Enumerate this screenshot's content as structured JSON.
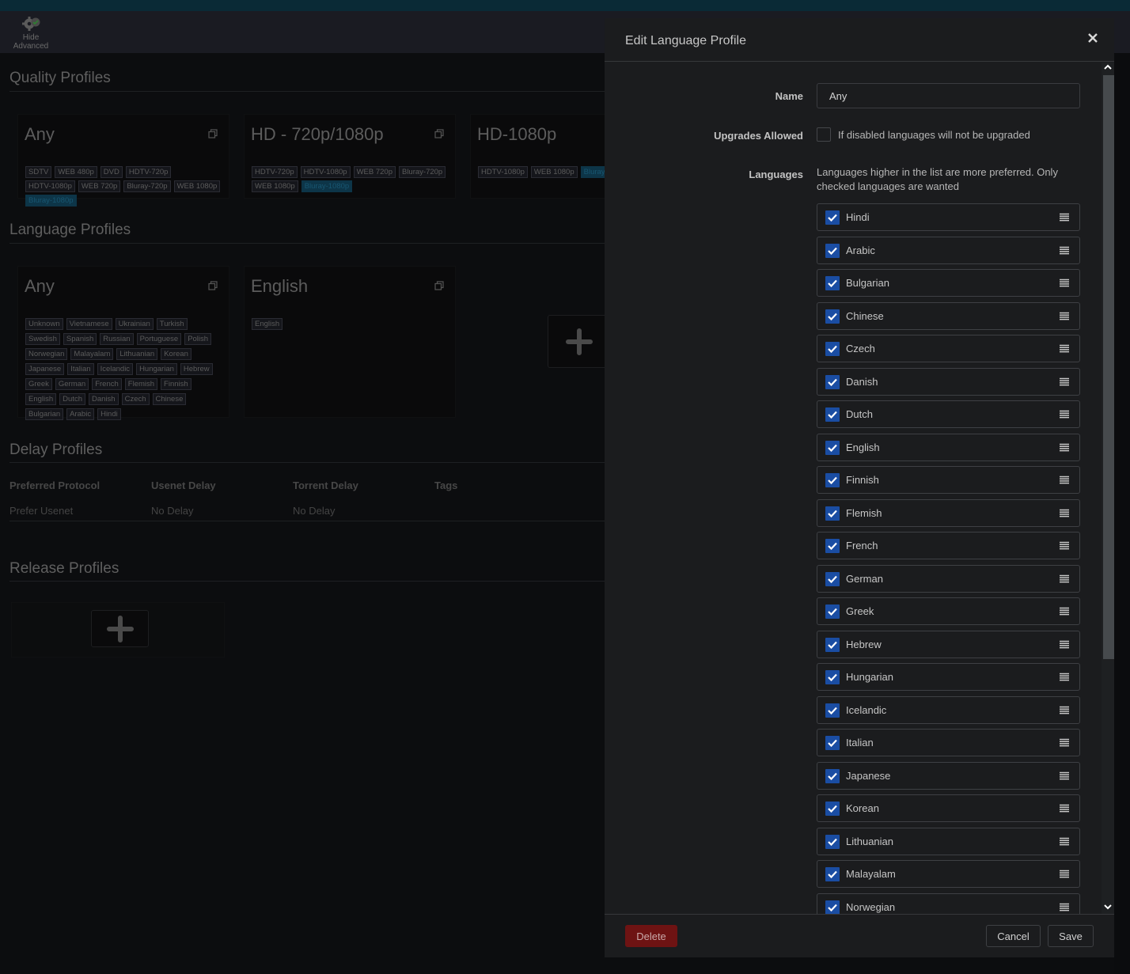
{
  "toolbar": {
    "hide_advanced_label_1": "Hide",
    "hide_advanced_label_2": "Advanced"
  },
  "quality_profiles": {
    "title": "Quality Profiles",
    "cards": [
      {
        "name": "Any",
        "tags": [
          "SDTV",
          "WEB 480p",
          "DVD",
          "HDTV-720p",
          "HDTV-1080p",
          "WEB 720p",
          "Bluray-720p",
          "WEB 1080p",
          "Bluray-1080p"
        ],
        "highlighted": "Bluray-1080p"
      },
      {
        "name": "HD - 720p/1080p",
        "tags": [
          "HDTV-720p",
          "HDTV-1080p",
          "WEB 720p",
          "Bluray-720p",
          "WEB 1080p",
          "Bluray-1080p"
        ],
        "highlighted": "Bluray-1080p"
      },
      {
        "name": "HD-1080p",
        "tags": [
          "HDTV-1080p",
          "WEB 1080p",
          "Bluray"
        ],
        "highlighted": "Bluray"
      }
    ]
  },
  "language_profiles": {
    "title": "Language Profiles",
    "cards": [
      {
        "name": "Any",
        "tags": [
          "Unknown",
          "Vietnamese",
          "Ukrainian",
          "Turkish",
          "Swedish",
          "Spanish",
          "Russian",
          "Portuguese",
          "Polish",
          "Norwegian",
          "Malayalam",
          "Lithuanian",
          "Korean",
          "Japanese",
          "Italian",
          "Icelandic",
          "Hungarian",
          "Hebrew",
          "Greek",
          "German",
          "French",
          "Flemish",
          "Finnish",
          "English",
          "Dutch",
          "Danish",
          "Czech",
          "Chinese",
          "Bulgarian",
          "Arabic",
          "Hindi"
        ]
      },
      {
        "name": "English",
        "tags": [
          "English"
        ]
      }
    ]
  },
  "delay_profiles": {
    "title": "Delay Profiles",
    "headers": [
      "Preferred Protocol",
      "Usenet Delay",
      "Torrent Delay",
      "Tags"
    ],
    "rows": [
      [
        "Prefer Usenet",
        "No Delay",
        "No Delay",
        ""
      ]
    ]
  },
  "release_profiles": {
    "title": "Release Profiles"
  },
  "modal": {
    "title": "Edit Language Profile",
    "name_label": "Name",
    "name_value": "Any",
    "upgrades_label": "Upgrades Allowed",
    "upgrades_checked": false,
    "upgrades_help": "If disabled languages will not be upgraded",
    "languages_label": "Languages",
    "languages_help": "Languages higher in the list are more preferred. Only checked languages are wanted",
    "languages": [
      {
        "name": "Hindi",
        "checked": true
      },
      {
        "name": "Arabic",
        "checked": true
      },
      {
        "name": "Bulgarian",
        "checked": true
      },
      {
        "name": "Chinese",
        "checked": true
      },
      {
        "name": "Czech",
        "checked": true
      },
      {
        "name": "Danish",
        "checked": true
      },
      {
        "name": "Dutch",
        "checked": true
      },
      {
        "name": "English",
        "checked": true
      },
      {
        "name": "Finnish",
        "checked": true
      },
      {
        "name": "Flemish",
        "checked": true
      },
      {
        "name": "French",
        "checked": true
      },
      {
        "name": "German",
        "checked": true
      },
      {
        "name": "Greek",
        "checked": true
      },
      {
        "name": "Hebrew",
        "checked": true
      },
      {
        "name": "Hungarian",
        "checked": true
      },
      {
        "name": "Icelandic",
        "checked": true
      },
      {
        "name": "Italian",
        "checked": true
      },
      {
        "name": "Japanese",
        "checked": true
      },
      {
        "name": "Korean",
        "checked": true
      },
      {
        "name": "Lithuanian",
        "checked": true
      },
      {
        "name": "Malayalam",
        "checked": true
      },
      {
        "name": "Norwegian",
        "checked": true
      }
    ],
    "delete_label": "Delete",
    "cancel_label": "Cancel",
    "save_label": "Save",
    "colors": {
      "accent_checkbox": "#1a4da3",
      "delete": "#6e1313"
    }
  }
}
